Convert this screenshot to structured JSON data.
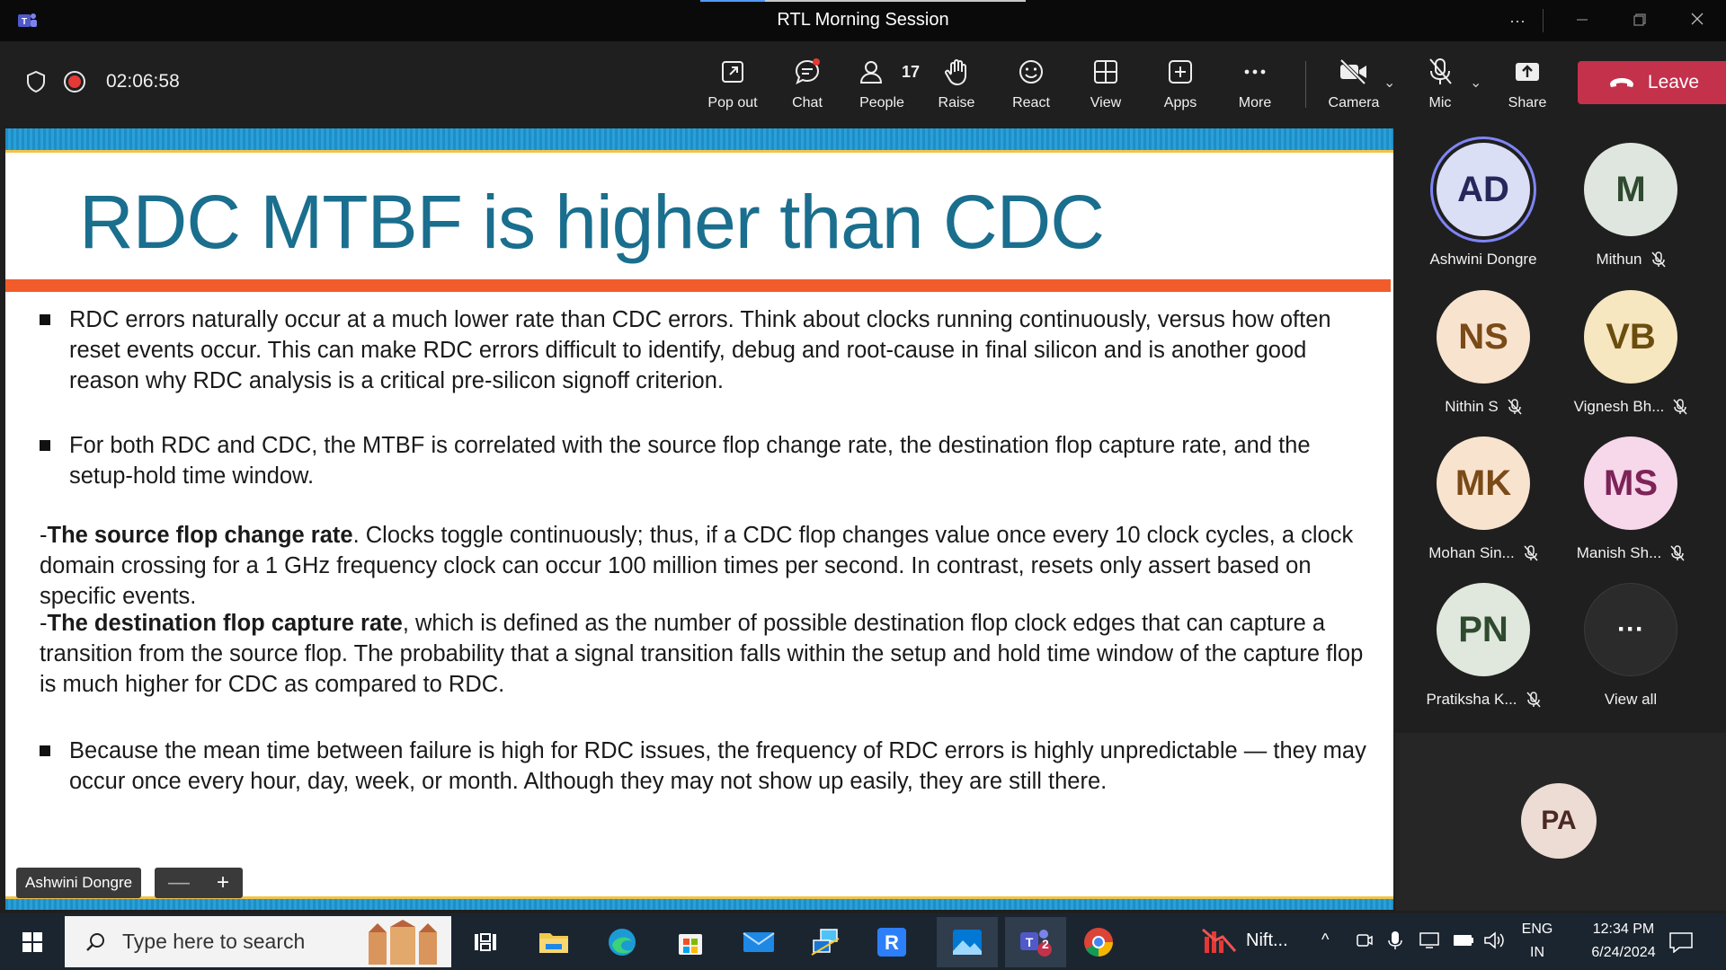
{
  "window": {
    "title": "RTL Morning Session"
  },
  "toolbar": {
    "recording_time": "02:06:58",
    "items": [
      {
        "label": "Pop out",
        "icon": "popout-icon"
      },
      {
        "label": "Chat",
        "icon": "chat-icon"
      },
      {
        "label": "People",
        "icon": "people-icon",
        "count": "17"
      },
      {
        "label": "Raise",
        "icon": "raise-hand-icon"
      },
      {
        "label": "React",
        "icon": "react-icon"
      },
      {
        "label": "View",
        "icon": "view-icon"
      },
      {
        "label": "Apps",
        "icon": "apps-icon"
      },
      {
        "label": "More",
        "icon": "more-icon"
      }
    ],
    "camera_label": "Camera",
    "mic_label": "Mic",
    "share_label": "Share",
    "leave_label": "Leave"
  },
  "slide": {
    "title": "RDC MTBF is higher than CDC",
    "bullet1": "RDC errors naturally occur at a much lower rate than CDC errors. Think about clocks running continuously, versus how often reset events occur. This can make RDC errors difficult to identify, debug and root-cause in final silicon and is another good reason why RDC analysis is a critical pre-silicon signoff criterion.",
    "bullet2": "For both RDC and CDC, the MTBF is correlated with the source flop change rate, the destination flop capture rate, and the setup-hold time window.",
    "para1_prefix": "-",
    "para1_bold": "The source flop change rate",
    "para1_text": ". Clocks toggle continuously; thus, if a CDC flop changes value once every 10 clock cycles, a clock domain crossing for a 1 GHz frequency clock can occur 100 million times per second. In contrast, resets only assert based on specific events.",
    "para2_prefix": "-",
    "para2_bold": "The destination flop capture rate",
    "para2_text": ", which is defined as the number of possible destination flop clock edges that can capture a transition from the source flop. The probability that a signal transition falls within the setup and hold time window of the capture flop is much higher for CDC as compared to RDC.",
    "bullet3": "Because the mean time between failure is high for RDC issues, the frequency of RDC errors is highly unpredictable — they may occur once every hour, day, week, or month. Although they may not show up easily, they are still there.",
    "presenter_tag": "Ashwini Dongre",
    "zoom_minus": "—",
    "zoom_plus": "+"
  },
  "participants": [
    {
      "initials": "AD",
      "name": "Ashwini Dongre",
      "muted": false,
      "bg": "#dbdff5",
      "fg": "#26275a"
    },
    {
      "initials": "M",
      "name": "Mithun",
      "muted": true,
      "bg": "#dfe6df",
      "fg": "#2f4a2f"
    },
    {
      "initials": "NS",
      "name": "Nithin S",
      "muted": true,
      "bg": "#f8e3cf",
      "fg": "#7a4a17"
    },
    {
      "initials": "VB",
      "name": "Vignesh Bh...",
      "muted": true,
      "bg": "#f6e7c1",
      "fg": "#6b4e0e"
    },
    {
      "initials": "MK",
      "name": "Mohan Sin...",
      "muted": true,
      "bg": "#f8e3cf",
      "fg": "#7a4a17"
    },
    {
      "initials": "MS",
      "name": "Manish Sh...",
      "muted": true,
      "bg": "#f7d7ea",
      "fg": "#7c2357"
    },
    {
      "initials": "PN",
      "name": "Pratiksha K...",
      "muted": true,
      "bg": "#e0e8dd",
      "fg": "#2f4a2f"
    },
    {
      "initials": "···",
      "name": "View all",
      "muted": false,
      "bg": "#2b2b2b",
      "fg": "#ffffff"
    }
  ],
  "bottom_tile": {
    "initials": "PA"
  },
  "taskbar": {
    "search_placeholder": "Type here to search",
    "teams_badge": "2",
    "nifty_label": "Nift...",
    "lang_line1": "ENG",
    "lang_line2": "IN",
    "time": "12:34 PM",
    "date": "6/24/2024"
  }
}
